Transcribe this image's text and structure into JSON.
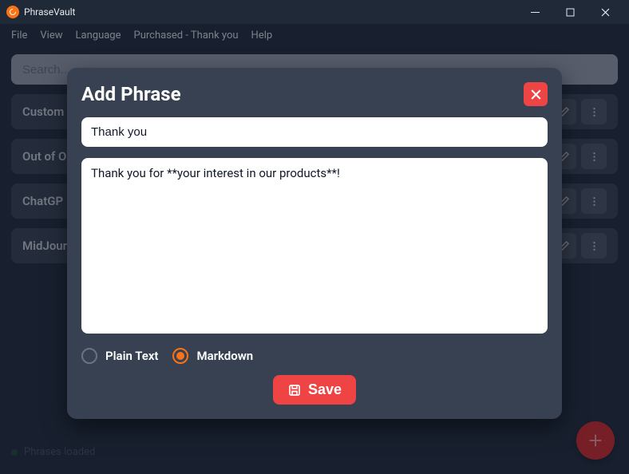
{
  "app": {
    "title": "PhraseVault"
  },
  "menu": {
    "file": "File",
    "view": "View",
    "language": "Language",
    "purchased": "Purchased - Thank you",
    "help": "Help"
  },
  "search": {
    "placeholder": "Search..."
  },
  "phrases": [
    {
      "title": "Custom"
    },
    {
      "title": "Out of O"
    },
    {
      "title": "ChatGP"
    },
    {
      "title": "MidJour"
    }
  ],
  "modal": {
    "title": "Add Phrase",
    "name_value": "Thank you",
    "body_value": "Thank you for **your interest in our products**!",
    "radio_plain": "Plain Text",
    "radio_markdown": "Markdown",
    "selected": "markdown",
    "save_label": "Save"
  },
  "status": {
    "text": "Phrases loaded"
  }
}
